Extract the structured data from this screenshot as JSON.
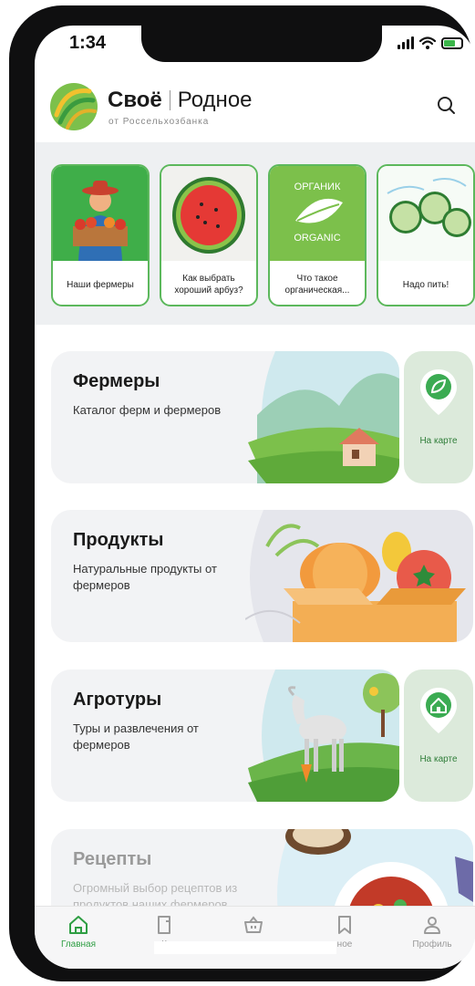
{
  "status": {
    "time": "1:34"
  },
  "brand": {
    "name_main": "Своё",
    "name_second": "Родное",
    "subtitle": "от Россельхозбанка"
  },
  "stories": [
    {
      "caption": "Наши фермеры"
    },
    {
      "caption": "Как выбрать хороший арбуз?"
    },
    {
      "caption": "Что такое органическая..."
    },
    {
      "caption": "Надо пить!"
    }
  ],
  "story_organic": {
    "top": "ОРГАНИК",
    "bottom": "ORGANIC"
  },
  "cards": [
    {
      "title": "Фермеры",
      "desc": "Каталог ферм и фермеров",
      "map": "На карте"
    },
    {
      "title": "Продукты",
      "desc": "Натуральные продукты от фермеров"
    },
    {
      "title": "Агротуры",
      "desc": "Туры и развлечения от фермеров",
      "map": "На карте"
    },
    {
      "title": "Рецепты",
      "desc": "Огромный выбор рецептов из продуктов наших фермеров"
    }
  ],
  "tabbar": [
    {
      "label": "Главная",
      "icon": "home-icon",
      "active": true
    },
    {
      "label": "К",
      "icon": "catalog-icon"
    },
    {
      "label": "",
      "icon": "basket-icon"
    },
    {
      "label": "ное",
      "icon": "bookmark-icon"
    },
    {
      "label": "Профиль",
      "icon": "profile-icon"
    }
  ],
  "colors": {
    "accent": "#2e9e43",
    "story_border": "#5cb85c"
  }
}
